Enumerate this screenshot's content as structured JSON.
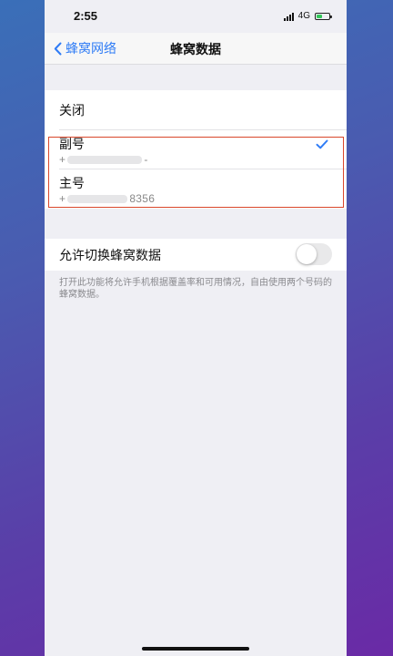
{
  "statusbar": {
    "time": "2:55",
    "network": "4G",
    "battery_level": 0.45
  },
  "navbar": {
    "back_label": "蜂窝网络",
    "title": "蜂窝数据"
  },
  "options": {
    "off_label": "关闭",
    "secondary": {
      "label": "副号",
      "number_prefix": "+",
      "number_suffix": "-",
      "selected": true
    },
    "primary": {
      "label": "主号",
      "number_prefix": "+",
      "number_suffix": "8356",
      "selected": false
    }
  },
  "switching": {
    "label": "允许切换蜂窝数据",
    "enabled": false,
    "footnote": "打开此功能将允许手机根据覆盖率和可用情况，自由使用两个号码的蜂窝数据。"
  },
  "colors": {
    "accent": "#2f7cf6",
    "highlight_border": "#d9472b"
  }
}
